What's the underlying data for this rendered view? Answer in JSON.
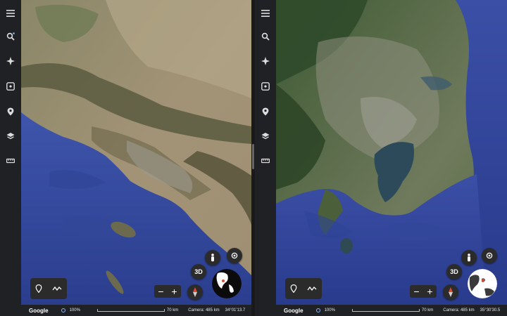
{
  "sidebar_icons": [
    "menu-icon",
    "search-icon",
    "voyager-icon",
    "feeling-lucky-icon",
    "projects-icon",
    "map-style-icon",
    "measure-icon"
  ],
  "colors": {
    "ui_dark": "#202124",
    "button": "#2b2b2b",
    "accent_blue": "#8ab4f8",
    "ocean": "#3b4fa3",
    "pegman": "#f4c430",
    "compass_red": "#e04a2f"
  },
  "left": {
    "controls": {
      "view_3d_label": "3D",
      "zoom_out_label": "−",
      "zoom_in_label": "+"
    },
    "statusbar": {
      "brand": "Google",
      "percent": "100%",
      "scale_label": "70 km",
      "camera": "Camera: 485 km",
      "coords": "34°01'13.7"
    }
  },
  "right": {
    "controls": {
      "view_3d_label": "3D",
      "zoom_out_label": "−",
      "zoom_in_label": "+"
    },
    "statusbar": {
      "brand": "Google",
      "percent": "100%",
      "scale_label": "70 km",
      "camera": "Camera: 485 km",
      "coords": "35°30'30.5"
    }
  }
}
